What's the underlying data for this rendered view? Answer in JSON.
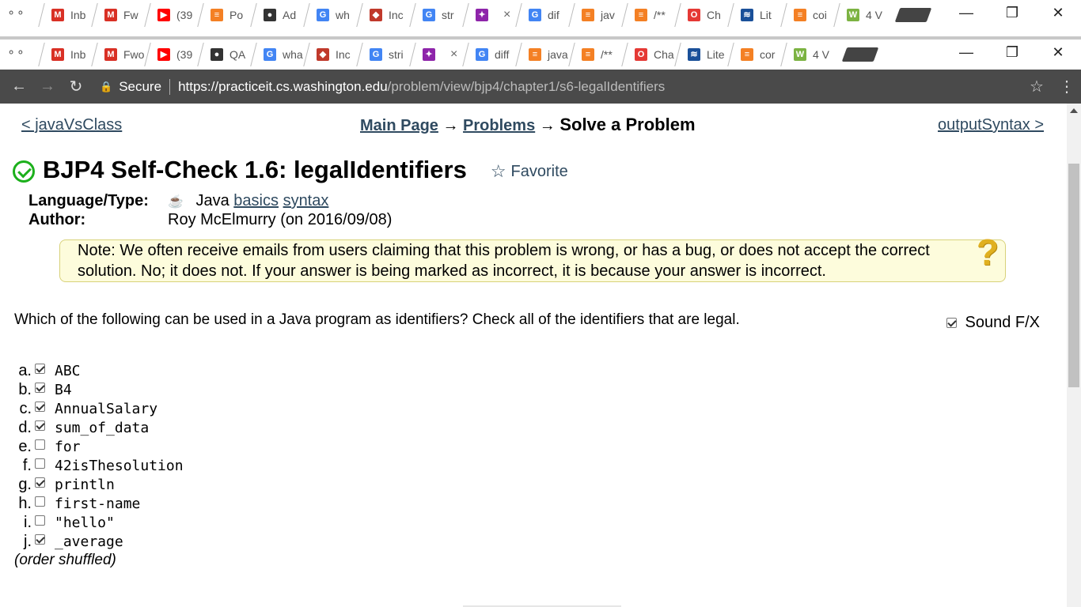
{
  "browser": {
    "back_tabs": [
      {
        "label": "Inb",
        "icon": "gmail-icon",
        "color": "#d93025"
      },
      {
        "label": "Fw",
        "icon": "gmail-icon",
        "color": "#d93025"
      },
      {
        "label": "(39",
        "icon": "youtube-icon",
        "color": "#ff0000"
      },
      {
        "label": "Po",
        "icon": "stackoverflow-icon",
        "color": "#f48024"
      },
      {
        "label": "Ad",
        "icon": "github-icon",
        "color": "#333333"
      },
      {
        "label": "wh",
        "icon": "google-icon",
        "color": "#4285f4"
      },
      {
        "label": "Inc",
        "icon": "cube-icon",
        "color": "#c0392b"
      },
      {
        "label": "str",
        "icon": "google-icon",
        "color": "#4285f4"
      },
      {
        "label": "",
        "icon": "pixel-icon",
        "color": "#8e24aa"
      },
      {
        "label": "dif",
        "icon": "google-icon",
        "color": "#4285f4"
      },
      {
        "label": "jav",
        "icon": "stackoverflow-icon",
        "color": "#f48024"
      },
      {
        "label": "/**",
        "icon": "stackoverflow-icon",
        "color": "#f48024"
      },
      {
        "label": "Ch",
        "icon": "oracle-icon",
        "color": "#e53935"
      },
      {
        "label": "Lit",
        "icon": "steemit-icon",
        "color": "#1a5099"
      },
      {
        "label": "coi",
        "icon": "stackoverflow-icon",
        "color": "#f48024"
      },
      {
        "label": "4 V",
        "icon": "wh-icon",
        "color": "#7cb342"
      }
    ],
    "front_tabs": [
      {
        "label": "Inb",
        "icon": "gmail-icon",
        "color": "#d93025"
      },
      {
        "label": "Fwo",
        "icon": "gmail-icon",
        "color": "#d93025"
      },
      {
        "label": "(39",
        "icon": "youtube-icon",
        "color": "#ff0000"
      },
      {
        "label": "QA",
        "icon": "github-icon",
        "color": "#333333"
      },
      {
        "label": "wha",
        "icon": "google-icon",
        "color": "#4285f4"
      },
      {
        "label": "Inc",
        "icon": "cube-icon",
        "color": "#c0392b"
      },
      {
        "label": "stri",
        "icon": "google-icon",
        "color": "#4285f4"
      },
      {
        "label": "",
        "icon": "pixel-icon",
        "color": "#8e24aa"
      },
      {
        "label": "diff",
        "icon": "google-icon",
        "color": "#4285f4"
      },
      {
        "label": "java",
        "icon": "stackoverflow-icon",
        "color": "#f48024"
      },
      {
        "label": "/**",
        "icon": "stackoverflow-icon",
        "color": "#f48024"
      },
      {
        "label": "Cha",
        "icon": "oracle-icon",
        "color": "#e53935"
      },
      {
        "label": "Lite",
        "icon": "steemit-icon",
        "color": "#1a5099"
      },
      {
        "label": "cor",
        "icon": "stackoverflow-icon",
        "color": "#f48024"
      },
      {
        "label": "4 V",
        "icon": "wh-icon",
        "color": "#7cb342"
      }
    ],
    "secure_label": "Secure",
    "url_host": "https://practiceit.cs.washington.edu",
    "url_path": "/problem/view/bjp4/chapter1/s6-legalIdentifiers"
  },
  "page": {
    "prev_link": "< javaVsClass",
    "next_link": "outputSyntax >",
    "crumb_main": "Main Page",
    "crumb_arrow": "→",
    "crumb_problems": "Problems",
    "crumb_current": "Solve a Problem",
    "title": "BJP4 Self-Check 1.6: legalIdentifiers",
    "favorite_label": "Favorite",
    "language_key": "Language/Type:",
    "language_value": "Java",
    "tag_basics": "basics",
    "tag_syntax": "syntax",
    "author_key": "Author:",
    "author_value": "Roy McElmurry (on 2016/09/08)",
    "note": "Note: We often receive emails from users claiming that this problem is wrong, or has a bug, or does not accept the correct solution. No; it does not. If your answer is being marked as incorrect, it is because your answer is incorrect.",
    "question": "Which of the following can be used in a Java program as identifiers? Check all of the identifiers that are legal.",
    "sound_label": "Sound F/X",
    "sound_checked": true,
    "choices": [
      {
        "letter": "a.",
        "text": "ABC",
        "checked": true
      },
      {
        "letter": "b.",
        "text": "B4",
        "checked": true
      },
      {
        "letter": "c.",
        "text": "AnnualSalary",
        "checked": true
      },
      {
        "letter": "d.",
        "text": "sum_of_data",
        "checked": true
      },
      {
        "letter": "e.",
        "text": "for",
        "checked": false
      },
      {
        "letter": "f.",
        "text": "42isThesolution",
        "checked": false
      },
      {
        "letter": "g.",
        "text": "println",
        "checked": true
      },
      {
        "letter": "h.",
        "text": "first-name",
        "checked": false
      },
      {
        "letter": "i.",
        "text": "\"hello\"",
        "checked": false
      },
      {
        "letter": "j.",
        "text": "_average",
        "checked": true
      }
    ],
    "shuffled_note": "(order shuffled)"
  }
}
